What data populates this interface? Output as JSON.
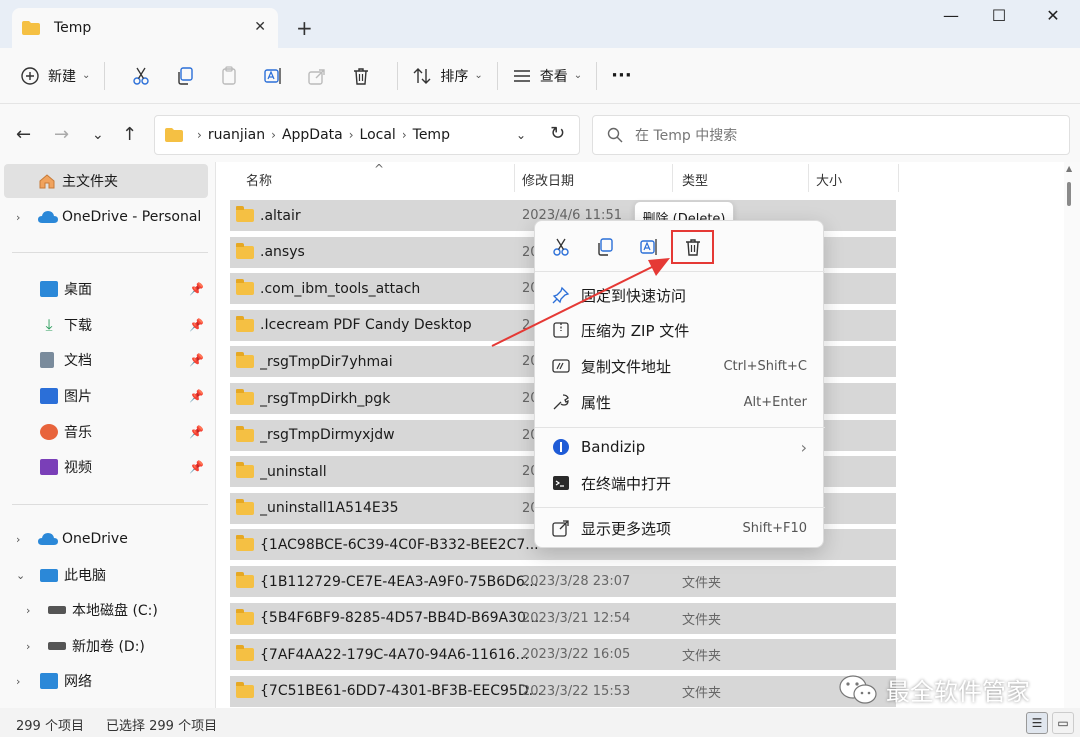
{
  "window": {
    "tab_title": "Temp",
    "close_tab": "✕",
    "new_tab": "+",
    "minimize": "—",
    "maximize": "☐",
    "close": "✕"
  },
  "toolbar": {
    "new_label": "新建",
    "sort_label": "排序",
    "view_label": "查看",
    "more_label": "···"
  },
  "address": {
    "crumbs": [
      "ruanjian",
      "AppData",
      "Local",
      "Temp"
    ],
    "search_placeholder": "在 Temp 中搜索"
  },
  "sidebar": {
    "home": "主文件夹",
    "onedrive_personal": "OneDrive - Personal",
    "quick": [
      {
        "label": "桌面",
        "icon": "desktop-icon",
        "color": "#2b88d8"
      },
      {
        "label": "下载",
        "icon": "download-icon",
        "color": "#2b9d5c"
      },
      {
        "label": "文档",
        "icon": "document-icon",
        "color": "#7a8b9c"
      },
      {
        "label": "图片",
        "icon": "pictures-icon",
        "color": "#2b6fd8"
      },
      {
        "label": "音乐",
        "icon": "music-icon",
        "color": "#e8643c"
      },
      {
        "label": "视频",
        "icon": "video-icon",
        "color": "#7a3fb8"
      }
    ],
    "onedrive": "OneDrive",
    "this_pc": "此电脑",
    "drive_c": "本地磁盘 (C:)",
    "drive_d": "新加卷 (D:)",
    "network": "网络"
  },
  "columns": {
    "name": "名称",
    "modified": "修改日期",
    "type": "类型",
    "size": "大小"
  },
  "files": [
    {
      "name": ".altair",
      "date": "2023/4/6 11:51",
      "type": ""
    },
    {
      "name": ".ansys",
      "date": "20",
      "type": ""
    },
    {
      "name": ".com_ibm_tools_attach",
      "date": "20",
      "type": ""
    },
    {
      "name": ".Icecream PDF Candy Desktop",
      "date": "2",
      "type": ""
    },
    {
      "name": "_rsgTmpDir7yhmai",
      "date": "20",
      "type": ""
    },
    {
      "name": "_rsgTmpDirkh_pgk",
      "date": "20",
      "type": ""
    },
    {
      "name": "_rsgTmpDirmyxjdw",
      "date": "20",
      "type": ""
    },
    {
      "name": "_uninstall",
      "date": "20",
      "type": ""
    },
    {
      "name": "_uninstall1A514E35",
      "date": "20",
      "type": ""
    },
    {
      "name": "{1AC98BCE-6C39-4C0F-B332-BEE2C7...",
      "date": "",
      "type": ""
    },
    {
      "name": "{1B112729-CE7E-4EA3-A9F0-75B6D6...",
      "date": "2023/3/28 23:07",
      "type": "文件夹"
    },
    {
      "name": "{5B4F6BF9-8285-4D57-BB4D-B69A30...",
      "date": "2023/3/21 12:54",
      "type": "文件夹"
    },
    {
      "name": "{7AF4AA22-179C-4A70-94A6-11616...",
      "date": "2023/3/22 16:05",
      "type": "文件夹"
    },
    {
      "name": "{7C51BE61-6DD7-4301-BF3B-EEC95D...",
      "date": "2023/3/22 15:53",
      "type": "文件夹"
    }
  ],
  "tooltip": "删除 (Delete)",
  "context_menu": {
    "pin": "固定到快速访问",
    "zip": "压缩为 ZIP 文件",
    "copy_path": "复制文件地址",
    "copy_path_shortcut": "Ctrl+Shift+C",
    "properties": "属性",
    "properties_shortcut": "Alt+Enter",
    "bandizip": "Bandizip",
    "terminal": "在终端中打开",
    "more_options": "显示更多选项",
    "more_options_shortcut": "Shift+F10"
  },
  "status": {
    "count": "299 个项目",
    "selected": "已选择 299 个项目"
  },
  "watermark": "最全软件管家",
  "colors": {
    "folder": "#f5c043",
    "highlight": "#e53935",
    "arrow": "#e53935"
  }
}
